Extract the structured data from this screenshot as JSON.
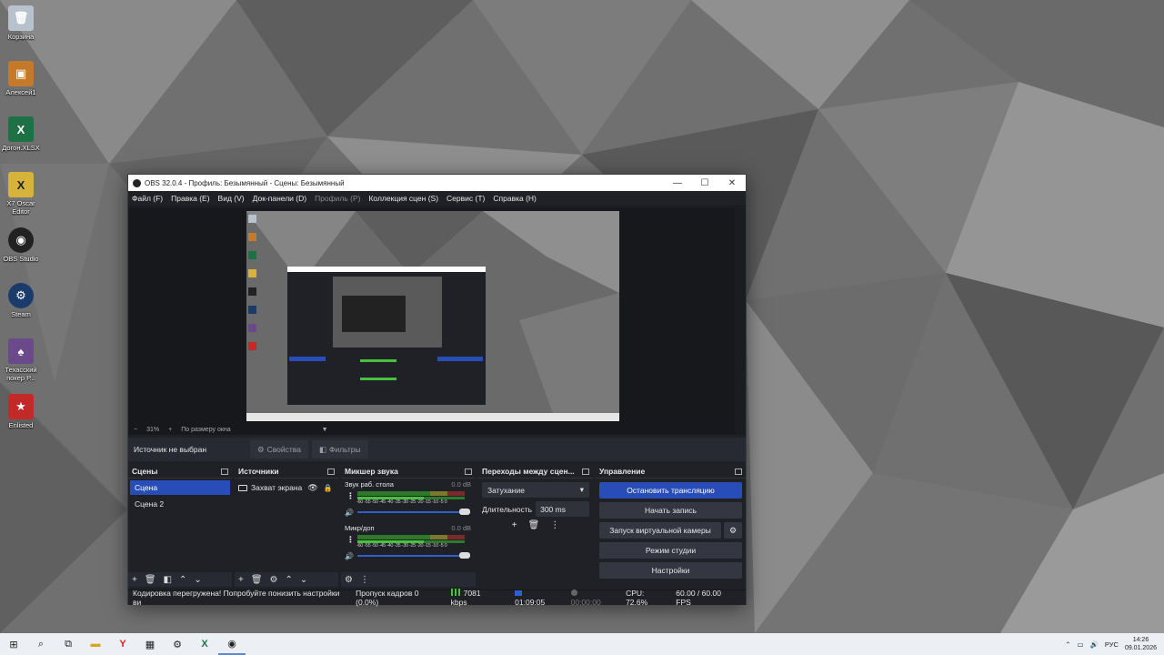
{
  "desktop": {
    "icons": [
      {
        "label": "Корзина",
        "icon": "recycle-bin-icon",
        "color": "#b8c2cc"
      },
      {
        "label": "Алексей1",
        "icon": "image-file-icon",
        "color": "#c47a2a"
      },
      {
        "label": "Догон.XLSX",
        "icon": "excel-icon",
        "color": "#1e7145"
      },
      {
        "label": "X7 Oscar Editor",
        "icon": "oscar-editor-icon",
        "color": "#d6b33a"
      },
      {
        "label": "OBS Studio",
        "icon": "obs-icon",
        "color": "#222222"
      },
      {
        "label": "Steam",
        "icon": "steam-icon",
        "color": "#1b3b6a"
      },
      {
        "label": "Техасский покер Р...",
        "icon": "poker-icon",
        "color": "#6a4a8a"
      },
      {
        "label": "Enlisted",
        "icon": "enlisted-icon",
        "color": "#c22a2a"
      }
    ]
  },
  "window": {
    "title": "OBS 32.0.4 - Профиль: Безымянный - Сцены: Безымянный",
    "min": "—",
    "max": "☐",
    "close": "✕"
  },
  "menu": [
    {
      "label": "Файл (F)",
      "disabled": false
    },
    {
      "label": "Правка (E)",
      "disabled": false
    },
    {
      "label": "Вид (V)",
      "disabled": false
    },
    {
      "label": "Док-панели (D)",
      "disabled": false
    },
    {
      "label": "Профиль (P)",
      "disabled": true
    },
    {
      "label": "Коллекция сцен (S)",
      "disabled": false
    },
    {
      "label": "Сервис (T)",
      "disabled": false
    },
    {
      "label": "Справка (H)",
      "disabled": false
    }
  ],
  "zoom": {
    "minus": "−",
    "value": "31%",
    "plus": "+",
    "fit": "По размеру окна",
    "arrow": "▼"
  },
  "source_bar": {
    "no_source": "Источник не выбран",
    "properties": "Свойства",
    "filters": "Фильтры"
  },
  "scenes": {
    "title": "Сцены",
    "items": [
      "Сцена",
      "Сцена 2"
    ],
    "selected": 0
  },
  "sources": {
    "title": "Источники",
    "items": [
      "Захват экрана"
    ]
  },
  "mixer": {
    "title": "Микшер звука",
    "channels": [
      {
        "name": "Звук раб. стола",
        "db": "0.0 dB"
      },
      {
        "name": "Микр/доп",
        "db": "0.0 dB"
      }
    ],
    "ticks": "-60 -55 -50 -45 -40 -35 -30 -25 -20 -15 -10 -5 0"
  },
  "transitions": {
    "title": "Переходы между сцен...",
    "selected": "Затухание",
    "duration_label": "Длительность",
    "duration_value": "300 ms"
  },
  "controls": {
    "title": "Управление",
    "stop_stream": "Остановить трансляцию",
    "start_record": "Начать запись",
    "virtual_cam": "Запуск виртуальной камеры",
    "studio_mode": "Режим студии",
    "settings": "Настройки"
  },
  "status": {
    "warning": "Кодировка перегружена! Попробуйте понизить настройки ви",
    "dropped": "Пропуск кадров 0 (0.0%)",
    "bitrate": "7081 kbps",
    "live_time": "01:09:05",
    "rec_time": "00:00:00",
    "cpu": "CPU: 72.6%",
    "fps": "60.00 / 60.00 FPS"
  },
  "taskbar": {
    "lang": "РУС",
    "time": "14:26",
    "date": "09.01.2026"
  },
  "colors": {
    "accent": "#284cb8",
    "panel": "#1f2126",
    "dock": "#272a33"
  }
}
